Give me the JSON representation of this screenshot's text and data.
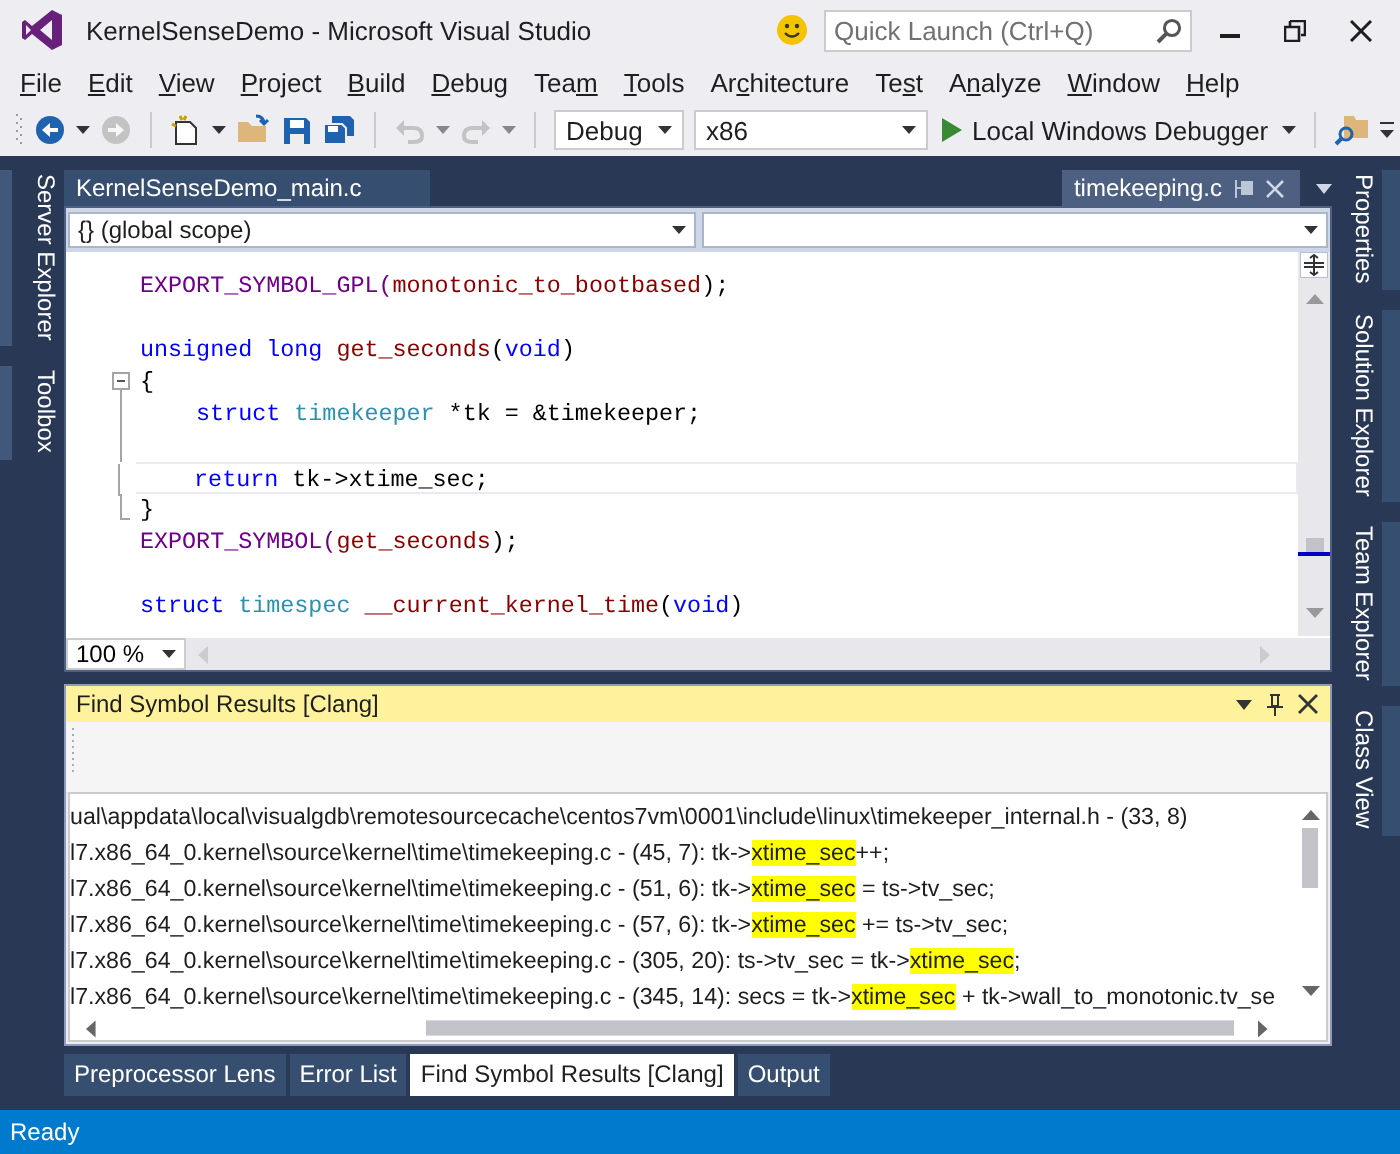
{
  "window": {
    "title": "KernelSenseDemo - Microsoft Visual Studio"
  },
  "quick_launch": {
    "placeholder": "Quick Launch (Ctrl+Q)"
  },
  "menu": [
    {
      "key": "F",
      "after": "ile"
    },
    {
      "key": "E",
      "after": "dit"
    },
    {
      "key": "V",
      "after": "iew"
    },
    {
      "key": "P",
      "after": "roject"
    },
    {
      "key": "B",
      "after": "uild"
    },
    {
      "key": "D",
      "after": "ebug"
    },
    {
      "before": "Tea",
      "key": "m"
    },
    {
      "key": "T",
      "after": "ools"
    },
    {
      "before": "Ar",
      "key": "c",
      "after": "hitecture"
    },
    {
      "before": "Te",
      "key": "s",
      "after": "t"
    },
    {
      "before": "A",
      "key": "n",
      "after": "alyze"
    },
    {
      "key": "W",
      "after": "indow"
    },
    {
      "key": "H",
      "after": "elp"
    }
  ],
  "toolbar": [
    {
      "kind": "grip",
      "disabled": false
    },
    {
      "kind": "back",
      "disabled": false
    },
    {
      "kind": "dropdown",
      "disabled": false
    },
    {
      "kind": "forward",
      "disabled": true
    },
    {
      "kind": "separator",
      "disabled": false
    },
    {
      "kind": "new",
      "disabled": false
    },
    {
      "kind": "dropdown",
      "disabled": false
    },
    {
      "kind": "open",
      "disabled": false
    },
    {
      "kind": "save",
      "disabled": false
    },
    {
      "kind": "save-all",
      "disabled": false
    },
    {
      "kind": "separator",
      "disabled": false
    },
    {
      "kind": "undo",
      "disabled": true
    },
    {
      "kind": "dropdown",
      "disabled": true
    },
    {
      "kind": "redo",
      "disabled": true
    },
    {
      "kind": "dropdown",
      "disabled": true
    },
    {
      "kind": "separator",
      "disabled": false
    },
    {
      "kind": "combo",
      "value": "Debug",
      "disabled": false
    },
    {
      "kind": "combo",
      "value": "x86",
      "disabled": false
    },
    {
      "kind": "start",
      "label": "Local Windows Debugger",
      "disabled": false
    },
    {
      "kind": "dropdown",
      "disabled": false
    },
    {
      "kind": "separator",
      "disabled": false
    },
    {
      "kind": "find",
      "disabled": false
    },
    {
      "kind": "overflow",
      "disabled": false
    }
  ],
  "left_tabs": [
    {
      "label": "Server Explorer"
    },
    {
      "label": "Toolbox"
    }
  ],
  "right_tabs": [
    {
      "label": "Properties"
    },
    {
      "label": "Solution Explorer"
    },
    {
      "label": "Team Explorer"
    },
    {
      "label": "Class View"
    }
  ],
  "editor": {
    "tabs": [
      {
        "label": "KernelSenseDemo_main.c",
        "selected": false
      },
      {
        "label": "timekeeping.c",
        "selected": true
      }
    ],
    "scope": "{} (global scope)",
    "zoom": "100 %",
    "lines": [
      {
        "kind": "code",
        "tokens": [
          {
            "t": "EXPORT_SYMBOL_GPL(",
            "kind": "macro"
          },
          {
            "t": "monotonic_to_bootbased",
            "kind": "func"
          },
          {
            "t": ");",
            "kind": "plain"
          }
        ]
      },
      {
        "kind": "code"
      },
      {
        "kind": "code",
        "tokens": [
          {
            "t": "unsigned long",
            "kind": "keyword"
          },
          {
            "t": " get_seconds",
            "kind": "func"
          },
          {
            "t": "(",
            "kind": "plain"
          },
          {
            "t": "void",
            "kind": "keyword"
          },
          {
            "t": ")",
            "kind": "plain"
          }
        ]
      },
      {
        "kind": "fold-start",
        "tokens": [
          {
            "t": "{",
            "kind": "plain"
          }
        ]
      },
      {
        "kind": "fold-inside",
        "indented": true,
        "tokens": [
          {
            "t": "struct",
            "kind": "keyword"
          },
          {
            "t": " timekeeper",
            "kind": "type"
          },
          {
            "t": " *tk = &timekeeper;",
            "kind": "plain"
          }
        ]
      },
      {
        "kind": "fold-inside"
      },
      {
        "kind": "fold-inside",
        "indented": true,
        "current": true,
        "tokens": [
          {
            "t": "return",
            "kind": "keyword"
          },
          {
            "t": " tk->xtime_sec;",
            "kind": "plain"
          }
        ]
      },
      {
        "kind": "fold-end",
        "tokens": [
          {
            "t": "}",
            "kind": "plain"
          }
        ]
      },
      {
        "kind": "code",
        "tokens": [
          {
            "t": "EXPORT_SYMBOL(",
            "kind": "macro"
          },
          {
            "t": "get_seconds",
            "kind": "func"
          },
          {
            "t": ");",
            "kind": "plain"
          }
        ]
      },
      {
        "kind": "code"
      },
      {
        "kind": "code",
        "tokens": [
          {
            "t": "struct",
            "kind": "keyword"
          },
          {
            "t": " timespec",
            "kind": "type"
          },
          {
            "t": " __current_kernel_time",
            "kind": "func"
          },
          {
            "t": "(",
            "kind": "plain"
          },
          {
            "t": "void",
            "kind": "keyword"
          },
          {
            "t": ")",
            "kind": "plain"
          }
        ]
      }
    ]
  },
  "results": {
    "title": "Find Symbol Results [Clang]",
    "lines": [
      [
        {
          "t": "ual\\appdata\\local\\visualgdb\\remotesourcecache\\centos7vm\\0001\\include\\linux\\timekeeper_internal.h - (33, 8)",
          "hl": false
        }
      ],
      [
        {
          "t": "l7.x86_64_0.kernel\\source\\kernel\\time\\timekeeping.c - (45, 7): tk->",
          "hl": false
        },
        {
          "t": "xtime_sec",
          "hl": true
        },
        {
          "t": "++;",
          "hl": false
        }
      ],
      [
        {
          "t": "l7.x86_64_0.kernel\\source\\kernel\\time\\timekeeping.c - (51, 6): tk->",
          "hl": false
        },
        {
          "t": "xtime_sec",
          "hl": true
        },
        {
          "t": " = ts->tv_sec;",
          "hl": false
        }
      ],
      [
        {
          "t": "l7.x86_64_0.kernel\\source\\kernel\\time\\timekeeping.c - (57, 6): tk->",
          "hl": false
        },
        {
          "t": "xtime_sec",
          "hl": true
        },
        {
          "t": " += ts->tv_sec;",
          "hl": false
        }
      ],
      [
        {
          "t": "l7.x86_64_0.kernel\\source\\kernel\\time\\timekeeping.c - (305, 20): ts->tv_sec = tk->",
          "hl": false
        },
        {
          "t": "xtime_sec",
          "hl": true
        },
        {
          "t": ";",
          "hl": false
        }
      ],
      [
        {
          "t": "l7.x86_64_0.kernel\\source\\kernel\\time\\timekeeping.c - (345, 14): secs = tk->",
          "hl": false
        },
        {
          "t": "xtime_sec",
          "hl": true
        },
        {
          "t": " + tk->wall_to_monotonic.tv_se",
          "hl": false
        }
      ]
    ],
    "tabs": [
      {
        "label": "Preprocessor Lens",
        "selected": false
      },
      {
        "label": "Error List",
        "selected": false
      },
      {
        "label": "Find Symbol Results [Clang]",
        "selected": true
      },
      {
        "label": "Output",
        "selected": false
      }
    ]
  },
  "status_bar": {
    "text": "Ready"
  }
}
